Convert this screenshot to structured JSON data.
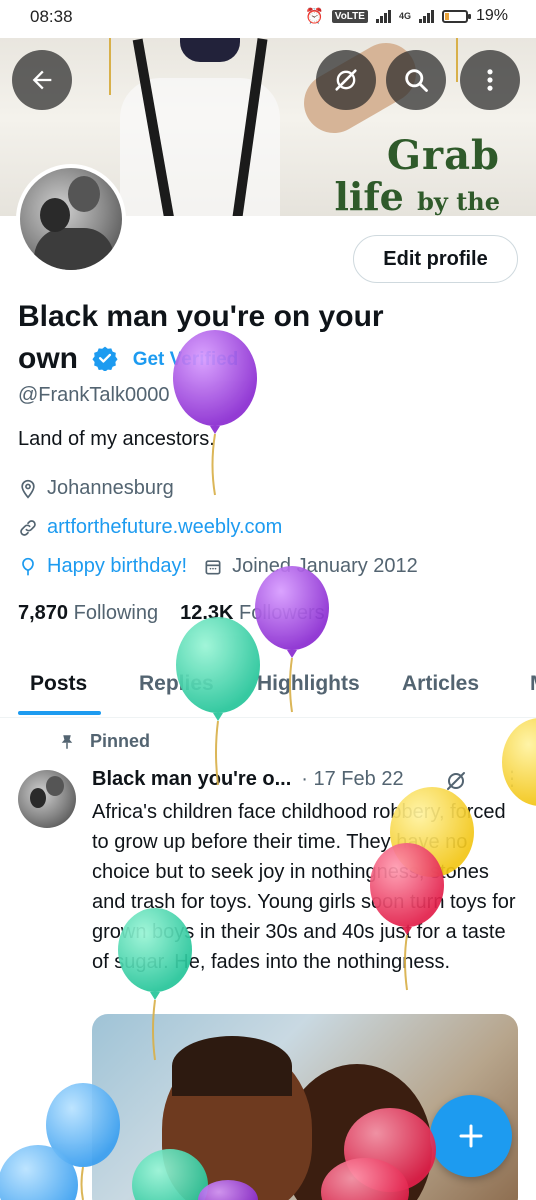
{
  "status_bar": {
    "time": "08:38",
    "volte": "VoLTE",
    "network": "4G",
    "battery": "19%",
    "battery_level": 0.19
  },
  "banner": {
    "text_line1": "Grab",
    "text_line2_a": "life",
    "text_line2_b": "by the"
  },
  "header_buttons": {
    "back_icon": "arrow-left-icon",
    "grok_icon": "grok-icon",
    "search_icon": "search-icon",
    "more_icon": "more-vertical-icon"
  },
  "profile": {
    "edit_profile_label": "Edit profile",
    "name_line1": "Black man you're on your",
    "name_line2": "own",
    "get_verified": "Get Verified",
    "handle": "@FrankTalk0000",
    "bio": "Land of my ancestors.",
    "location": "Johannesburg",
    "website": "artforthefuture.weebly.com",
    "birthday": "Happy birthday!",
    "joined": "Joined January 2012",
    "following_count": "7,870",
    "following_label": "Following",
    "followers_count": "12.3K",
    "followers_label": "Followers"
  },
  "tabs": [
    {
      "label": "Posts",
      "active": true
    },
    {
      "label": "Replies",
      "active": false
    },
    {
      "label": "Highlights",
      "active": false
    },
    {
      "label": "Articles",
      "active": false
    },
    {
      "label": "M",
      "active": false
    }
  ],
  "post": {
    "pinned_label": "Pinned",
    "author": "Black man you're o...",
    "date": "· 17 Feb 22",
    "text": "Africa's children face childhood robbery, forced to grow up before their time. They have no choice but to seek joy in nothingness, stones and trash for toys. Young girls soon turn toys for grown boys in their 30s and 40s just for a taste of sugar. He, fades into the nothingness."
  },
  "colors": {
    "accent": "#1d9bf0",
    "text_primary": "#0f1419",
    "text_secondary": "#536471"
  }
}
